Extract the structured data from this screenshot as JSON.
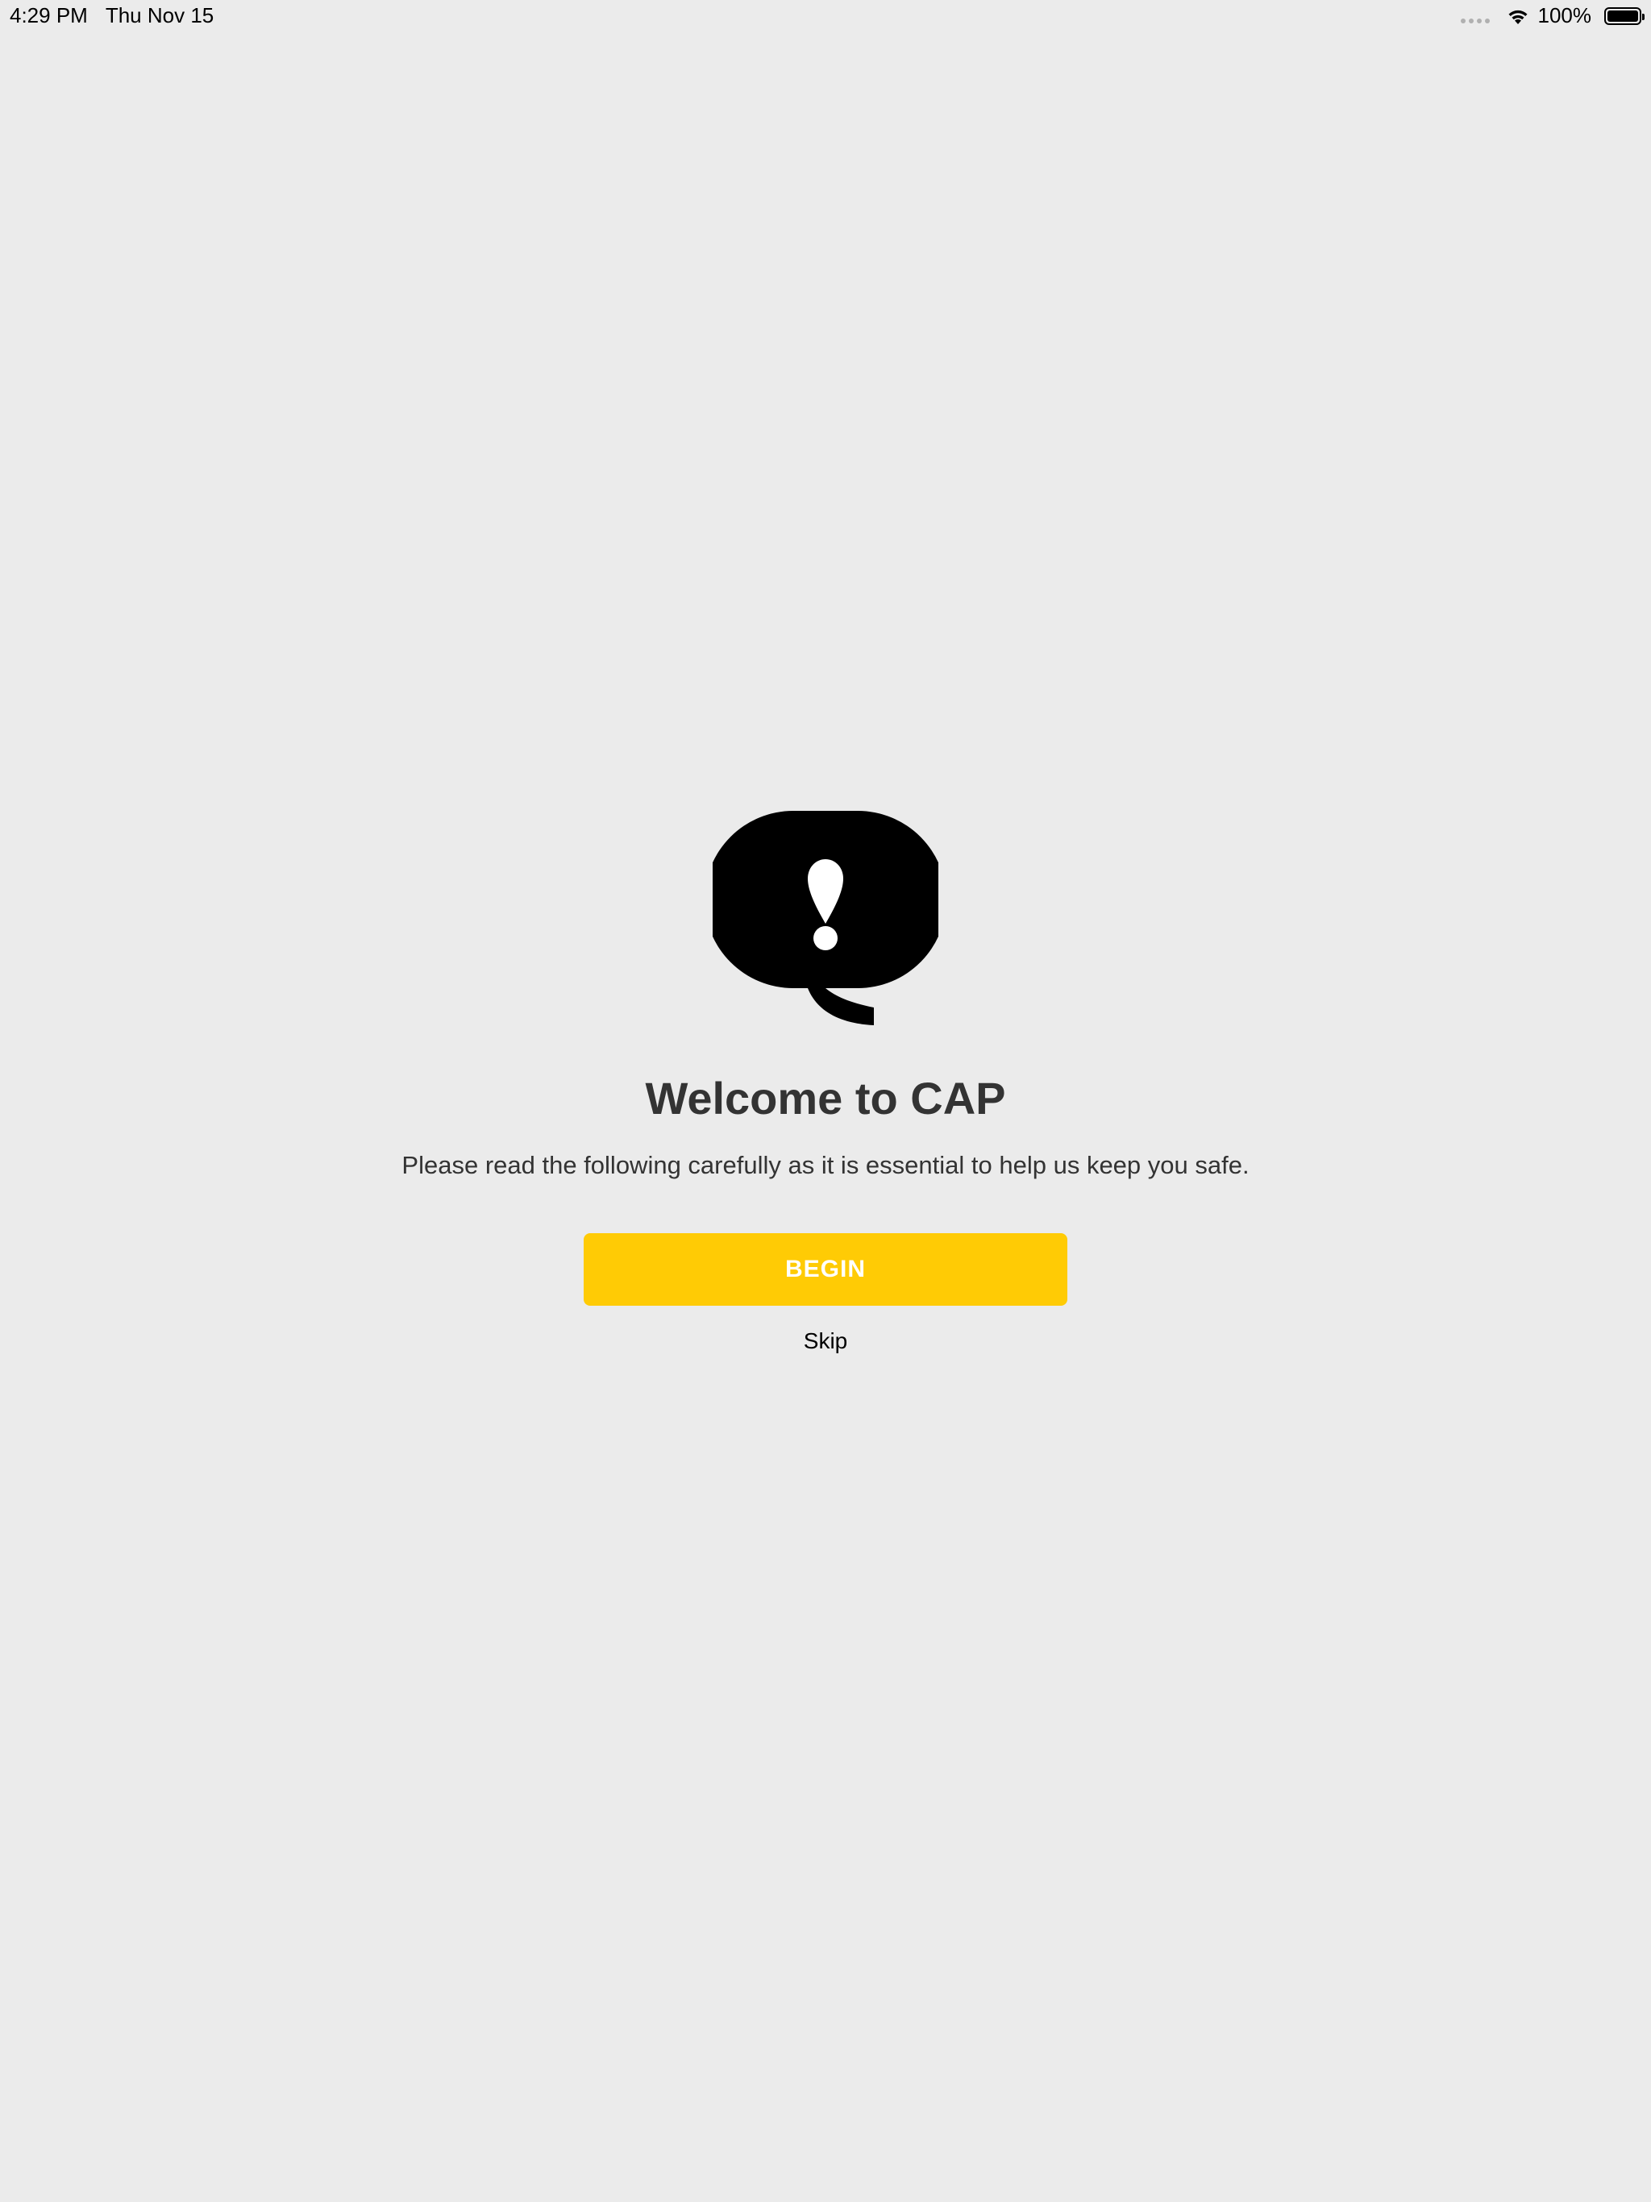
{
  "status_bar": {
    "time": "4:29 PM",
    "date": "Thu Nov 15",
    "battery_percent": "100%",
    "icons": [
      "signal-dots-icon",
      "wifi-icon",
      "battery-icon"
    ]
  },
  "welcome": {
    "logo_icon": "speech-bubble-exclamation-icon",
    "title": "Welcome to CAP",
    "subtitle": "Please read the following carefully as it is essential to help us keep you safe.",
    "begin_label": "BEGIN",
    "skip_label": "Skip"
  },
  "colors": {
    "background": "#ebebeb",
    "accent": "#ffcb05",
    "text": "#333333"
  }
}
